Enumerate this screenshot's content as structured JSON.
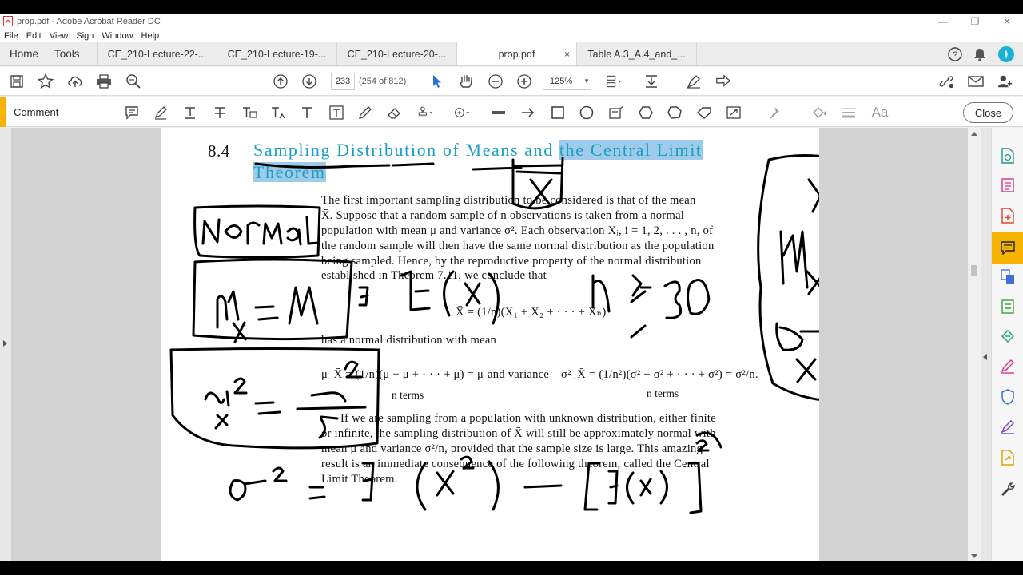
{
  "window": {
    "title": "prop.pdf - Adobe Acrobat Reader DC"
  },
  "menu": [
    "File",
    "Edit",
    "View",
    "Sign",
    "Window",
    "Help"
  ],
  "tabs": {
    "home": "Home",
    "tools": "Tools",
    "documents": [
      {
        "label": "CE_210-Lecture-22-...",
        "active": false
      },
      {
        "label": "CE_210-Lecture-19-...",
        "active": false
      },
      {
        "label": "CE_210-Lecture-20-...",
        "active": false
      },
      {
        "label": "prop.pdf",
        "active": true,
        "close": "×"
      },
      {
        "label": "Table A.3_A.4_and_...",
        "active": false
      }
    ]
  },
  "toolbar": {
    "page_current": "233",
    "page_count": "(254 of 812)",
    "zoom": "125%"
  },
  "comment": {
    "label": "Comment",
    "close_label": "Close",
    "font_tool": "Aa",
    "accent_color": "#f6b400"
  },
  "pdf": {
    "section_number": "8.4",
    "heading_part1": "Sampling Distribution of Means and ",
    "heading_part2": "the Central Limit",
    "heading_line2": "Theorem",
    "p1_lines": [
      "The first important sampling distribution to be considered is that of the mean",
      "X̄.  Suppose that a random sample of n observations is taken from a normal",
      "population with mean μ and variance σ². Each observation Xᵢ, i = 1, 2, . . . , n, of",
      "the random sample will then have the same normal distribution as the population",
      "being sampled. Hence, by the reproductive property of the normal distribution",
      "established in Theorem 7.11, we conclude that"
    ],
    "eq1": "X̄ = (1/n)(X₁ + X₂ + · · · + Xₙ)",
    "p2": "has a normal distribution with mean",
    "eq2_left": "μ_X̄ = (1/n)(μ + μ + · · · + μ) = μ",
    "eq2_mid": "and variance",
    "eq2_right": "σ²_X̄ = (1/n²)(σ² + σ² + · · · + σ²) = σ²/n.",
    "n_terms": "n terms",
    "p3_lines": [
      "If we are sampling from a population with unknown distribution, either finite",
      "or infinite, the sampling distribution of X̄ will still be approximately normal with",
      "mean μ and variance σ²/n, provided that the sample size is large. This amazing",
      "result is an immediate consequence of the following theorem, called the Central",
      "Limit Theorem."
    ]
  },
  "ink_color": "#000000",
  "highlight_color": "#9fcbea",
  "heading_color": "#1a9fc1"
}
